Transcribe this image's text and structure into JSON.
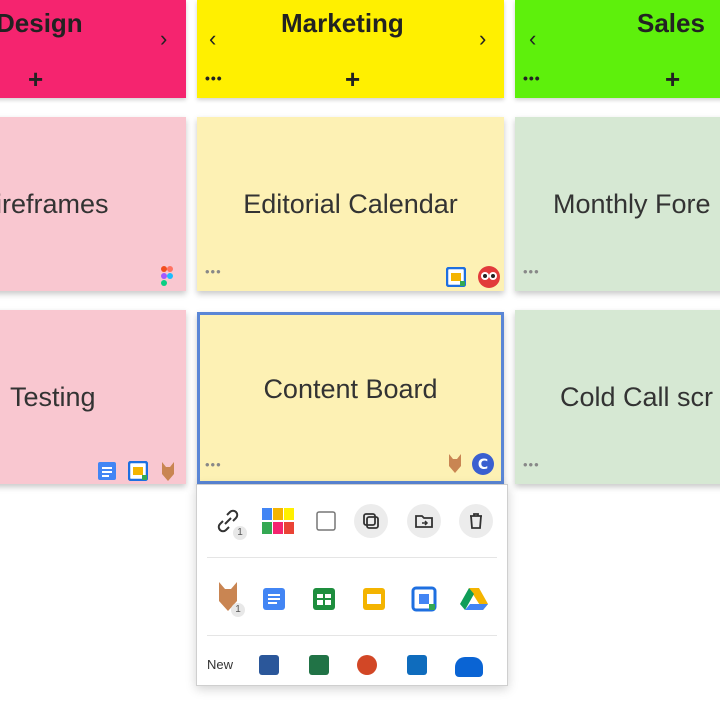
{
  "columns": [
    {
      "title": "Design",
      "color": "#f5246f",
      "prev_icon": "",
      "next_icon": "›",
      "add_icon": "+"
    },
    {
      "title": "Marketing",
      "color": "#fff000",
      "prev_icon": "‹",
      "next_icon": "›",
      "add_icon": "+"
    },
    {
      "title": "Sales",
      "color": "#5ef00c",
      "prev_icon": "‹",
      "next_icon": "",
      "add_icon": "+"
    }
  ],
  "more_icon": "•••",
  "cards": [
    {
      "title": "ireframes",
      "color": "#f9c7d0"
    },
    {
      "title": "Editorial Calendar",
      "color": "#fdf1b4"
    },
    {
      "title": "Monthly Fore",
      "color": "#d6e8d3"
    },
    {
      "title": "Testing",
      "color": "#f9c7d0"
    },
    {
      "title": "Content Board",
      "color": "#fdf1b4"
    },
    {
      "title": "Cold Call scr",
      "color": "#d6e8d3"
    }
  ],
  "popup": {
    "badge_link": "1",
    "badge_user": "1",
    "bottom_partial_label": "New"
  },
  "accent": "#5a86d6"
}
